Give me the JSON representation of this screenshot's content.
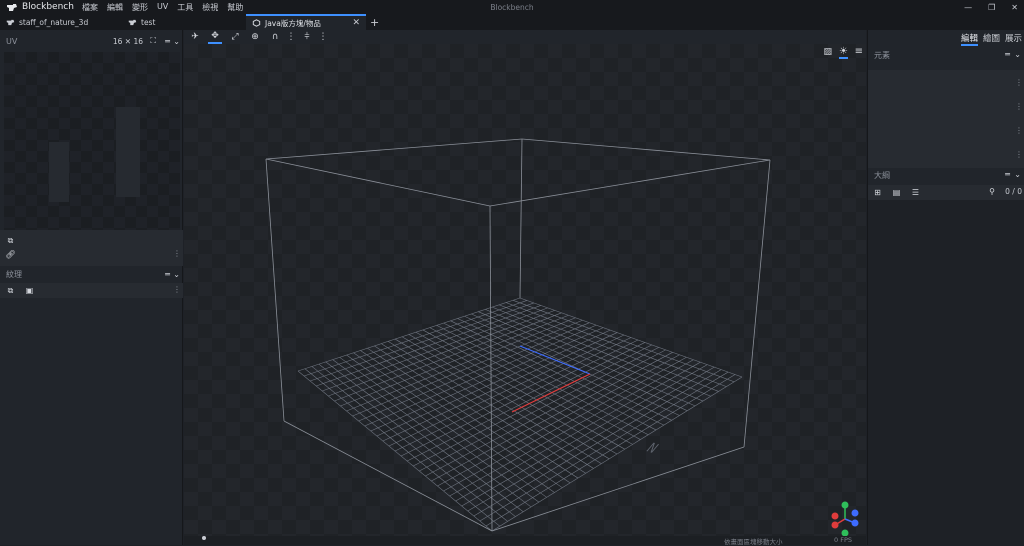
{
  "app": {
    "name": "Blockbench",
    "window_title": "Blockbench",
    "menu": [
      "檔案",
      "編輯",
      "變形",
      "UV",
      "工具",
      "檢視",
      "幫助"
    ]
  },
  "tabs": [
    {
      "label": "staff_of_nature_3d",
      "active": false
    },
    {
      "label": "test",
      "active": false
    },
    {
      "label": "Java版方塊/物品",
      "active": true
    }
  ],
  "new_tab_label": "+",
  "left_panel": {
    "uv_title": "UV",
    "uv_size": "16 ✕ 16",
    "texture_title": "紋理"
  },
  "right_panel": {
    "mode_tabs": [
      {
        "label": "編輯",
        "active": true
      },
      {
        "label": "繪圖",
        "active": false
      },
      {
        "label": "展示",
        "active": false
      }
    ],
    "elements_title": "元素",
    "outliner_title": "大綱",
    "outliner_count": "0 / 0"
  },
  "viewport": {
    "compass_label": "N",
    "status_hint": "依畫面區塊移動大小",
    "fps": "0 FPS"
  },
  "colors": {
    "accent": "#3e90ff",
    "axis_x": "#e03c3c",
    "axis_y": "#2fbf5b",
    "axis_z": "#3e6cff",
    "grid": "#6f7580"
  }
}
